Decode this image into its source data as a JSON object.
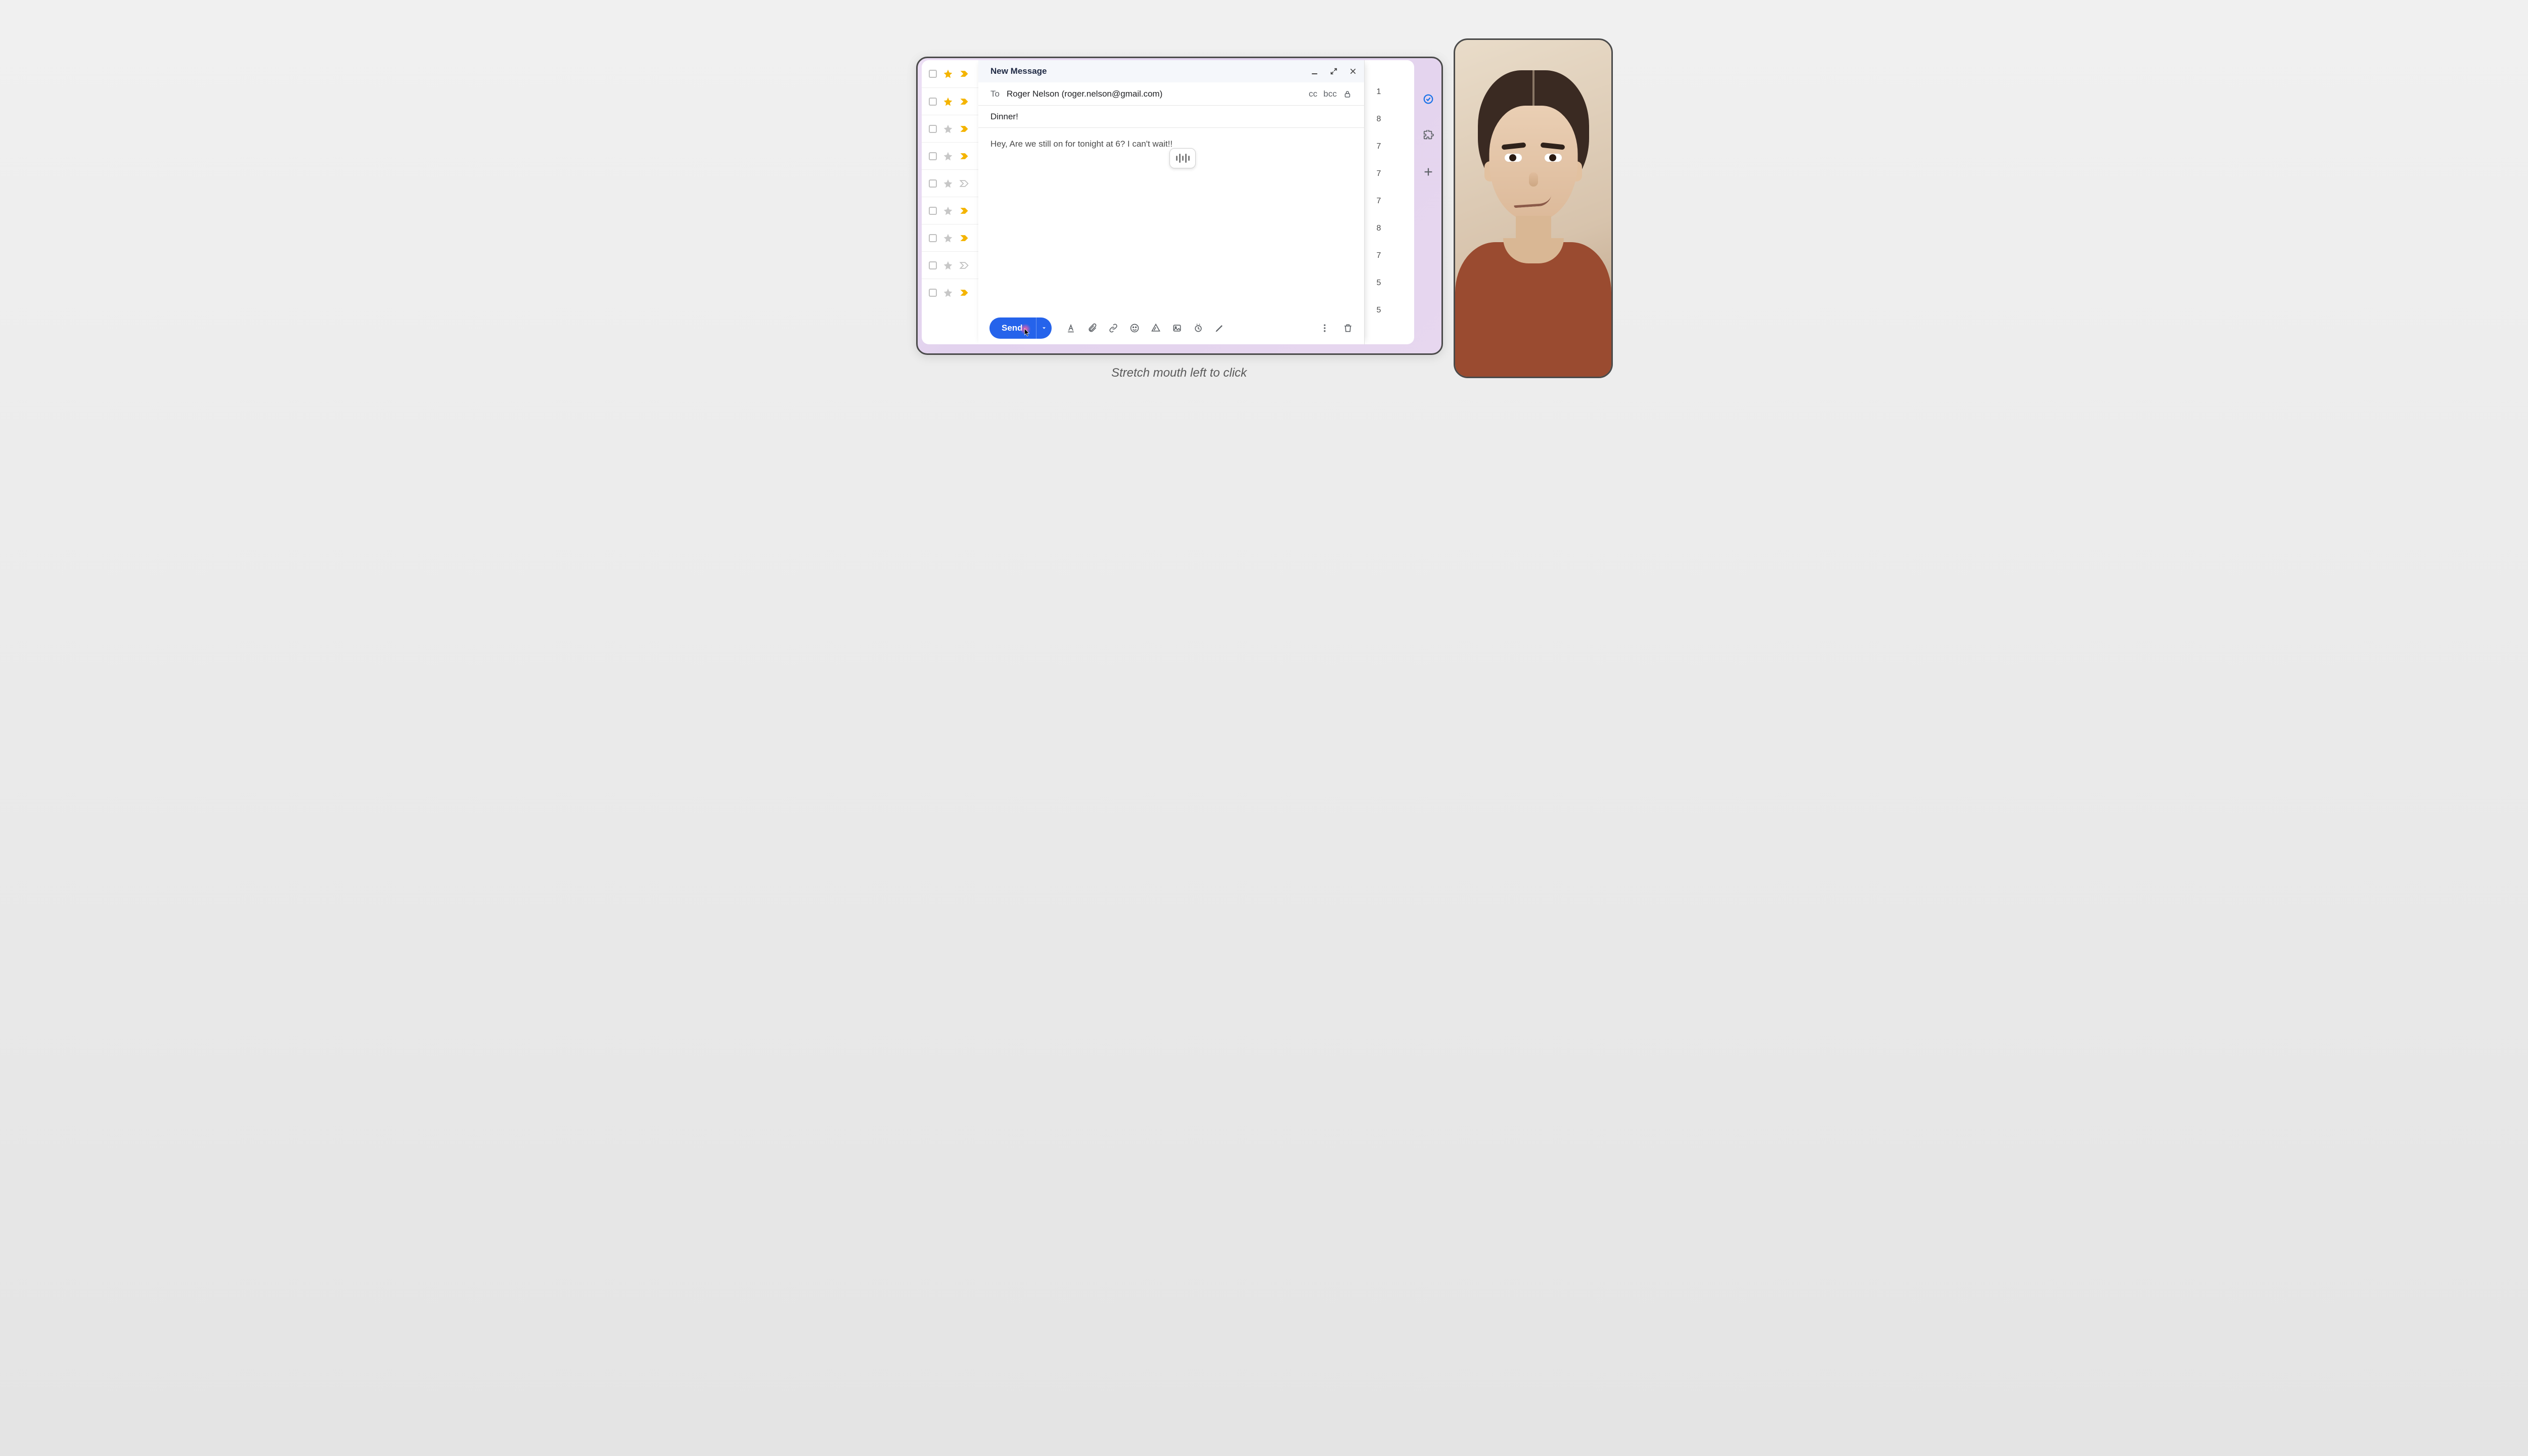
{
  "compose": {
    "title": "New Message",
    "to_label": "To",
    "to_value": "Roger Nelson (roger.nelson@gmail.com)",
    "cc_label": "cc",
    "bcc_label": "bcc",
    "subject": "Dinner!",
    "body": "Hey, Are we still on for tonight at 6? I can't wait!!",
    "send_label": "Send"
  },
  "inbox_rows": [
    {
      "starred": true,
      "important": true,
      "trail": "1"
    },
    {
      "starred": true,
      "important": true,
      "trail": "8"
    },
    {
      "starred": false,
      "important": true,
      "trail": "7"
    },
    {
      "starred": false,
      "important": true,
      "trail": "7"
    },
    {
      "starred": false,
      "important": false,
      "trail": "7"
    },
    {
      "starred": false,
      "important": true,
      "trail": "8"
    },
    {
      "starred": false,
      "important": true,
      "trail": "7"
    },
    {
      "starred": false,
      "important": false,
      "trail": "5"
    },
    {
      "starred": false,
      "important": true,
      "trail": "5"
    }
  ],
  "caption": "Stretch mouth left to click"
}
